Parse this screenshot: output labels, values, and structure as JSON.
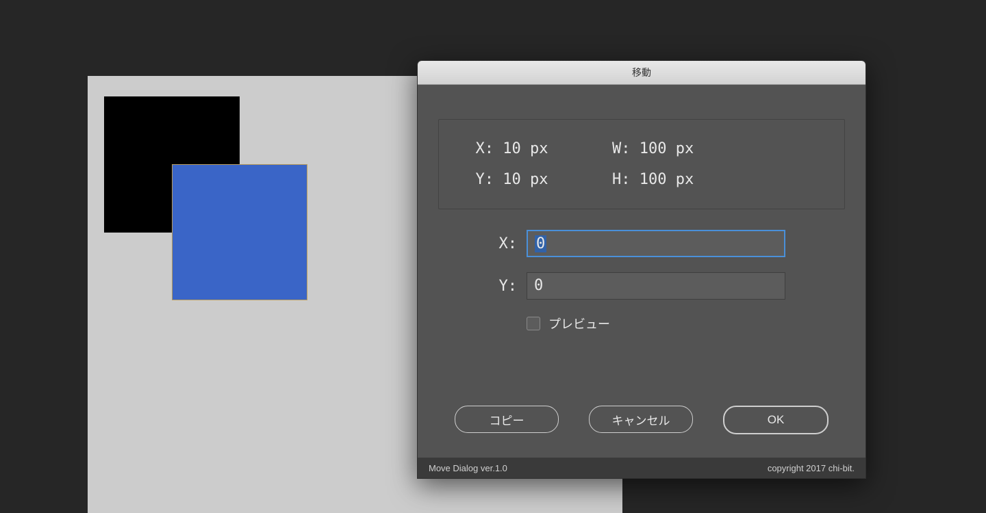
{
  "dialog": {
    "title": "移動",
    "info": {
      "x_label": "X:",
      "x_value": "10 px",
      "y_label": "Y:",
      "y_value": "10 px",
      "w_label": "W:",
      "w_value": "100 px",
      "h_label": "H:",
      "h_value": "100 px"
    },
    "inputs": {
      "x_label": "X:",
      "x_value": "0",
      "y_label": "Y:",
      "y_value": "0"
    },
    "preview_label": "プレビュー",
    "buttons": {
      "copy": "コピー",
      "cancel": "キャンセル",
      "ok": "OK"
    },
    "footer": {
      "left": "Move Dialog ver.1.0",
      "right": "copyright 2017 chi-bit."
    }
  }
}
